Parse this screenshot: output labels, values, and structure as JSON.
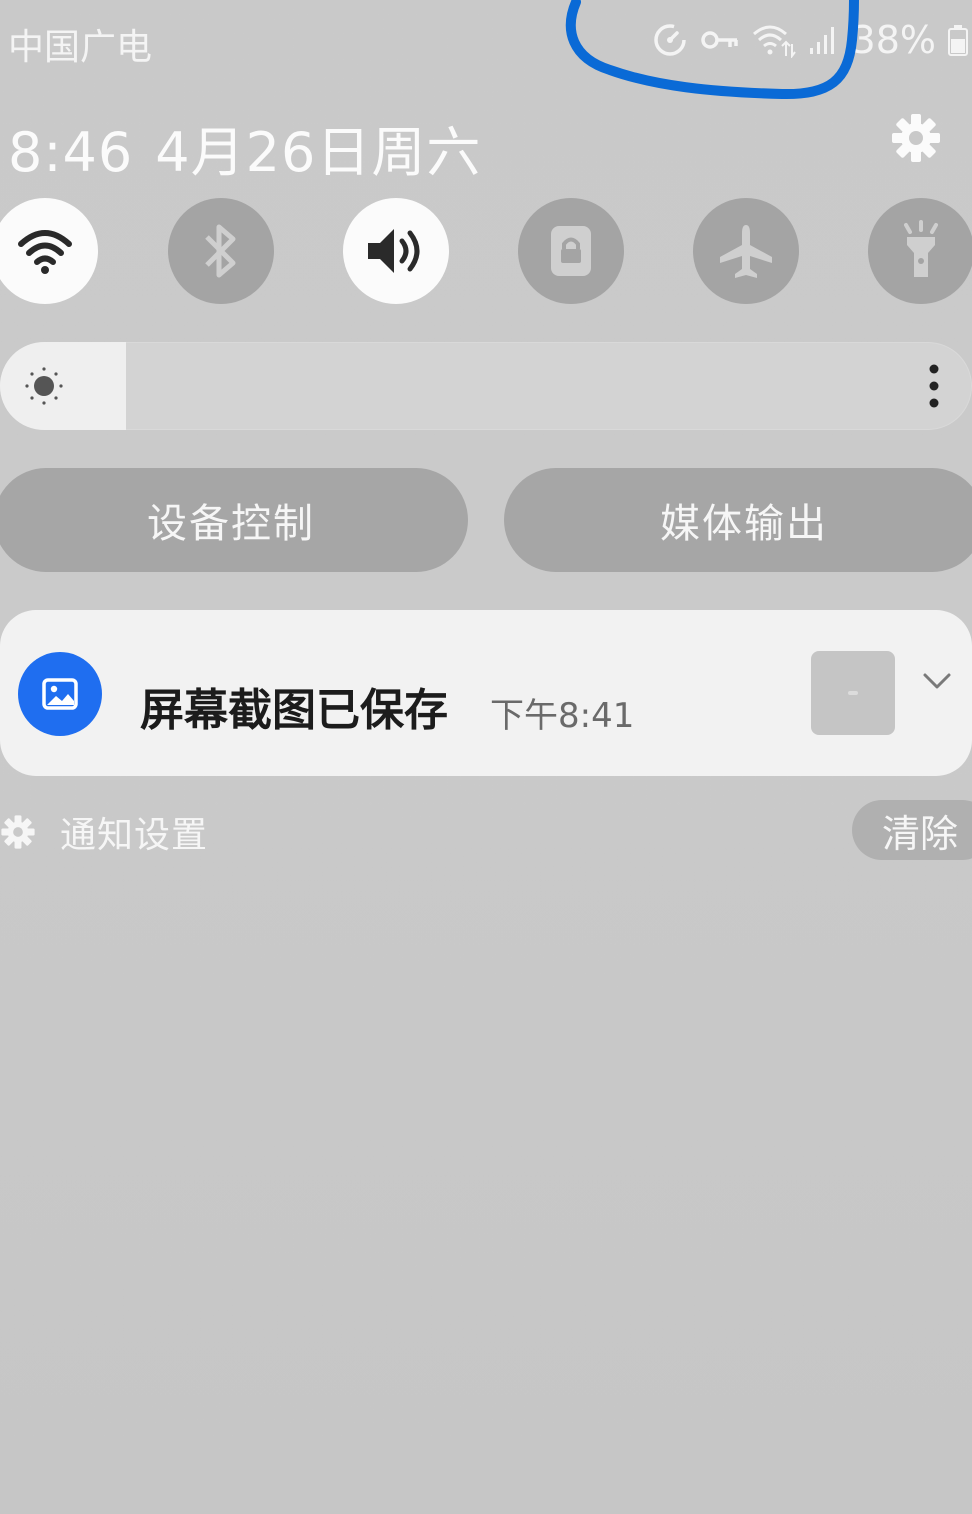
{
  "status_bar": {
    "carrier": "中国广电",
    "battery_percent": "38%",
    "icons": [
      "data-saver-icon",
      "vpn-key-icon",
      "wifi-data-icon",
      "signal-icon",
      "battery-icon"
    ]
  },
  "header": {
    "time": "8:46",
    "date": "4月26日周六",
    "settings_icon": "gear-icon"
  },
  "quick_settings": [
    {
      "id": "wifi",
      "icon": "wifi-icon",
      "state": "on"
    },
    {
      "id": "bluetooth",
      "icon": "bluetooth-icon",
      "state": "off"
    },
    {
      "id": "sound",
      "icon": "speaker-icon",
      "state": "on"
    },
    {
      "id": "rotation-lock",
      "icon": "lock-icon",
      "state": "off"
    },
    {
      "id": "airplane",
      "icon": "airplane-icon",
      "state": "off"
    },
    {
      "id": "flashlight",
      "icon": "flashlight-icon",
      "state": "off"
    }
  ],
  "brightness": {
    "level": 0.13,
    "icon": "sun-icon",
    "more_icon": "more-vertical-icon"
  },
  "buttons": {
    "device_control": "设备控制",
    "media_output": "媒体输出"
  },
  "notification": {
    "title": "屏幕截图已保存",
    "time": "下午8:41",
    "app_icon": "image-icon"
  },
  "footer": {
    "settings_label": "通知设置",
    "clear_label": "清除"
  },
  "colors": {
    "accent_blue": "#1f6ef0",
    "scribble": "#0a6ad6",
    "panel_bg": "#c9c9c9"
  }
}
